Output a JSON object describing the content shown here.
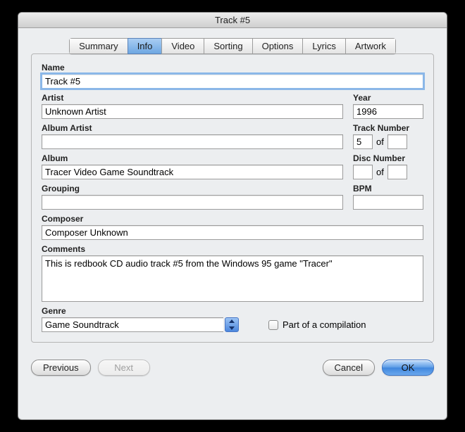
{
  "window": {
    "title": "Track #5"
  },
  "tabs": {
    "summary": "Summary",
    "info": "Info",
    "video": "Video",
    "sorting": "Sorting",
    "options": "Options",
    "lyrics": "Lyrics",
    "artwork": "Artwork"
  },
  "labels": {
    "name": "Name",
    "artist": "Artist",
    "year": "Year",
    "album_artist": "Album Artist",
    "track_number": "Track Number",
    "album": "Album",
    "disc_number": "Disc Number",
    "grouping": "Grouping",
    "bpm": "BPM",
    "composer": "Composer",
    "comments": "Comments",
    "genre": "Genre",
    "of": "of",
    "compilation": "Part of a compilation"
  },
  "values": {
    "name": "Track #5",
    "artist": "Unknown Artist",
    "year": "1996",
    "album_artist": "",
    "track_number": "5",
    "track_total": "",
    "album": "Tracer Video Game Soundtrack",
    "disc_number": "",
    "disc_total": "",
    "grouping": "",
    "bpm": "",
    "composer": "Composer Unknown",
    "comments": "This is redbook CD audio track #5 from the Windows 95 game \"Tracer\"",
    "genre": "Game Soundtrack",
    "compilation_checked": false
  },
  "buttons": {
    "previous": "Previous",
    "next": "Next",
    "cancel": "Cancel",
    "ok": "OK"
  }
}
